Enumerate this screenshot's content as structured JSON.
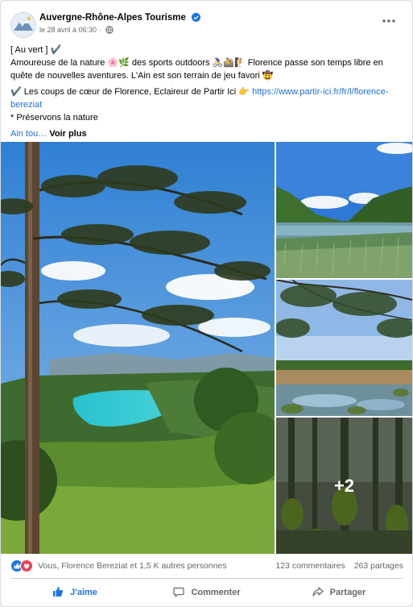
{
  "post": {
    "page_name": "Auvergne-Rhône-Alpes Tourisme",
    "timestamp": "le 28 avril à 06:30",
    "text": {
      "line1": "[ Au vert ] ✔️",
      "line2": "Amoureuse de la nature 🌸🌿 des sports outdoors 🚴‍♀️🚵🧗 Florence passe son temps libre en",
      "line3": "quête de nouvelles aventures. L'Ain est son terrain de jeu favori 🤠",
      "line4_prefix": "✔️ Les coups de cœur de Florence, Eclaireur de Partir Ici 👉",
      "link_part1": "https://www.partir-ici.fr/fr/l/florence-",
      "link_part2": "bereziat",
      "line6": "* Préservons la nature",
      "hashtag_fragment": "Ain tou…",
      "see_more": "Voir plus"
    },
    "photos": {
      "more_count": "+2"
    },
    "stats": {
      "reactions_text": "Vous, Florence Bereziat et 1,5 K autres personnes",
      "comments": "123 commentaires",
      "shares": "263 partages"
    },
    "actions": {
      "like": "J'aime",
      "comment": "Commenter",
      "share": "Partager"
    }
  },
  "colors": {
    "brand_blue": "#1b74e4",
    "link": "#216fdb",
    "text_secondary": "#65676b",
    "love_red": "#f33e58"
  },
  "icons": [
    "verified-badge-icon",
    "globe-icon",
    "more-options-icon",
    "like-reaction-icon",
    "love-reaction-icon",
    "thumbs-up-icon",
    "comment-icon",
    "share-icon"
  ]
}
